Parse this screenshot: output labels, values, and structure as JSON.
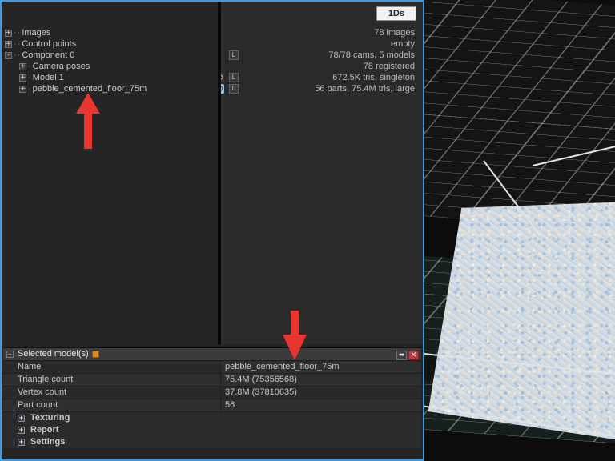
{
  "viewport": {
    "name": "3d-viewport"
  },
  "tree": {
    "badge": "1Ds",
    "rows": [
      {
        "label": "Images",
        "value": "78 images",
        "expander": "+",
        "level": 0,
        "marker": false,
        "eye": "none",
        "layer": false
      },
      {
        "label": "Control points",
        "value": "empty",
        "expander": "+",
        "level": 0,
        "marker": false,
        "eye": "none",
        "layer": false
      },
      {
        "label": "Component 0",
        "value": "78/78 cams, 5 models",
        "expander": "-",
        "level": 0,
        "marker": true,
        "eye": "none",
        "layer": true
      },
      {
        "label": "Camera poses",
        "value": "78 registered",
        "expander": "+",
        "level": 1,
        "marker": false,
        "eye": "none",
        "layer": false
      },
      {
        "label": "Model 1",
        "value": "672.5K tris, singleton",
        "expander": "+",
        "level": 1,
        "marker": false,
        "eye": "off",
        "layer": true
      },
      {
        "label": "pebble_cemented_floor_75m",
        "value": "56 parts, 75.4M tris, large",
        "expander": "+",
        "level": 1,
        "marker": true,
        "eye": "on",
        "layer": true
      }
    ]
  },
  "properties": {
    "title": "Selected model(s)",
    "collapse_glyph": "–",
    "dock_glyph": "⬌",
    "close_glyph": "✕",
    "rows": [
      {
        "name": "Name",
        "value": "pebble_cemented_floor_75m"
      },
      {
        "name": "Triangle count",
        "value": "75.4M (75356568)"
      },
      {
        "name": "Vertex count",
        "value": "37.8M (37810635)"
      },
      {
        "name": "Part count",
        "value": "56"
      }
    ],
    "sections": [
      {
        "label": "Texturing",
        "expander": "+"
      },
      {
        "label": "Report",
        "expander": "+"
      },
      {
        "label": "Settings",
        "expander": "+"
      }
    ]
  },
  "annotations": {
    "color": "#e8352e",
    "arrow_up": "arrow-pointing-to-pebble-model-tree-item",
    "arrow_down": "arrow-pointing-to-name-value"
  }
}
